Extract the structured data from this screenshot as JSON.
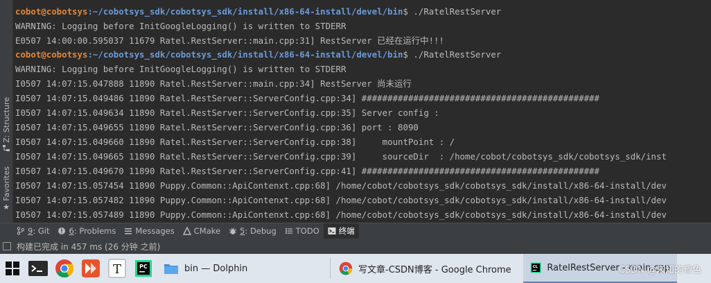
{
  "terminal": {
    "lines": [
      {
        "type": "prompt",
        "user": "cobot@cobotsys",
        "path": ":~/cobotsys_sdk/cobotsys_sdk/install/x86-64-install/devel/bin",
        "cmd": "$ ./RatelRestServer"
      },
      {
        "type": "text",
        "text": "WARNING: Logging before InitGoogleLogging() is written to STDERR"
      },
      {
        "type": "text",
        "text": "E0507 14:00:00.595037 11679 Ratel.RestServer::main.cpp:31] RestServer 已经在运行中!!!"
      },
      {
        "type": "prompt",
        "user": "cobot@cobotsys",
        "path": ":~/cobotsys_sdk/cobotsys_sdk/install/x86-64-install/devel/bin",
        "cmd": "$ ./RatelRestServer"
      },
      {
        "type": "text",
        "text": "WARNING: Logging before InitGoogleLogging() is written to STDERR"
      },
      {
        "type": "text",
        "text": "I0507 14:07:15.047888 11890 Ratel.RestServer::main.cpp:34] RestServer 尚未运行"
      },
      {
        "type": "text",
        "text": "I0507 14:07:15.049486 11890 Ratel.RestServer::ServerConfig.cpp:34] ##############################################"
      },
      {
        "type": "text",
        "text": "I0507 14:07:15.049634 11890 Ratel.RestServer::ServerConfig.cpp:35] Server config :"
      },
      {
        "type": "text",
        "text": "I0507 14:07:15.049655 11890 Ratel.RestServer::ServerConfig.cpp:36] port : 8090"
      },
      {
        "type": "text",
        "text": "I0507 14:07:15.049660 11890 Ratel.RestServer::ServerConfig.cpp:38]     mountPoint : /"
      },
      {
        "type": "text",
        "text": "I0507 14:07:15.049665 11890 Ratel.RestServer::ServerConfig.cpp:39]     sourceDir  : /home/cobot/cobotsys_sdk/cobotsys_sdk/inst"
      },
      {
        "type": "text",
        "text": "I0507 14:07:15.049670 11890 Ratel.RestServer::ServerConfig.cpp:41] ##############################################"
      },
      {
        "type": "text",
        "text": "I0507 14:07:15.057454 11890 Puppy.Common::ApiContenxt.cpp:68] /home/cobot/cobotsys_sdk/cobotsys_sdk/install/x86-64-install/dev"
      },
      {
        "type": "text",
        "text": "I0507 14:07:15.057482 11890 Puppy.Common::ApiContenxt.cpp:68] /home/cobot/cobotsys_sdk/cobotsys_sdk/install/x86-64-install/dev"
      },
      {
        "type": "text",
        "text": "I0507 14:07:15.057489 11890 Puppy.Common::ApiContenxt.cpp:68] /home/cobot/cobotsys_sdk/cobotsys_sdk/install/x86-64-install/dev"
      }
    ]
  },
  "side_tabs": [
    {
      "label": "Z: Structure",
      "icon": "structure-icon"
    },
    {
      "label": "Favorites",
      "icon": "star-icon"
    }
  ],
  "tool_tabs": [
    {
      "num": "9",
      "label": ": Git",
      "icon": "git-branch-icon"
    },
    {
      "num": "6",
      "label": ": Problems",
      "icon": "problems-icon"
    },
    {
      "num": "",
      "label": "Messages",
      "icon": "messages-icon"
    },
    {
      "num": "",
      "label": "CMake",
      "icon": "cmake-icon"
    },
    {
      "num": "5",
      "label": ": Debug",
      "icon": "bug-icon"
    },
    {
      "num": "",
      "label": "TODO",
      "icon": "todo-icon"
    },
    {
      "num": "",
      "label": "终端",
      "icon": "terminal-icon",
      "active": true
    }
  ],
  "status": {
    "text": "构建已完成 in 457 ms (26 分钟 之前)"
  },
  "taskbar": {
    "tasks": [
      {
        "label": "bin — Dolphin",
        "icon": "dolphin-folder-icon"
      },
      {
        "label": "写文章-CSDN博客 - Google Chrome",
        "icon": "chrome-icon"
      },
      {
        "label": "RatelRestServer - main.cpp",
        "icon": "clion-icon",
        "active": true
      }
    ]
  },
  "watermark": "CSDN @未知的昏色",
  "colors": {
    "prompt_user": "#e0883a",
    "prompt_path": "#6b9bd8",
    "terminal_bg": "#2b2b2b",
    "text": "#bbbbbb"
  }
}
